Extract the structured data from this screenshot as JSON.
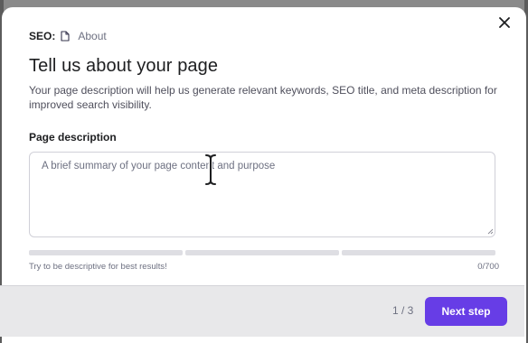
{
  "breadcrumb": {
    "label": "SEO:",
    "page_name": "About"
  },
  "title": "Tell us about your page",
  "description": "Your page description will help us generate relevant keywords, SEO title, and meta description for improved search visibility.",
  "field": {
    "label": "Page description",
    "value": "",
    "placeholder": "A brief summary of your page content and purpose",
    "hint": "Try to be descriptive for best results!",
    "counter": "0/700",
    "strength_segments": 3
  },
  "footer": {
    "step": "1 / 3",
    "next_label": "Next step"
  },
  "colors": {
    "accent": "#673de6",
    "text": "#1d1e20",
    "muted": "#6d7081"
  },
  "icons": {
    "close": "close-icon",
    "page": "page-icon",
    "cursor": "text-cursor-icon"
  }
}
